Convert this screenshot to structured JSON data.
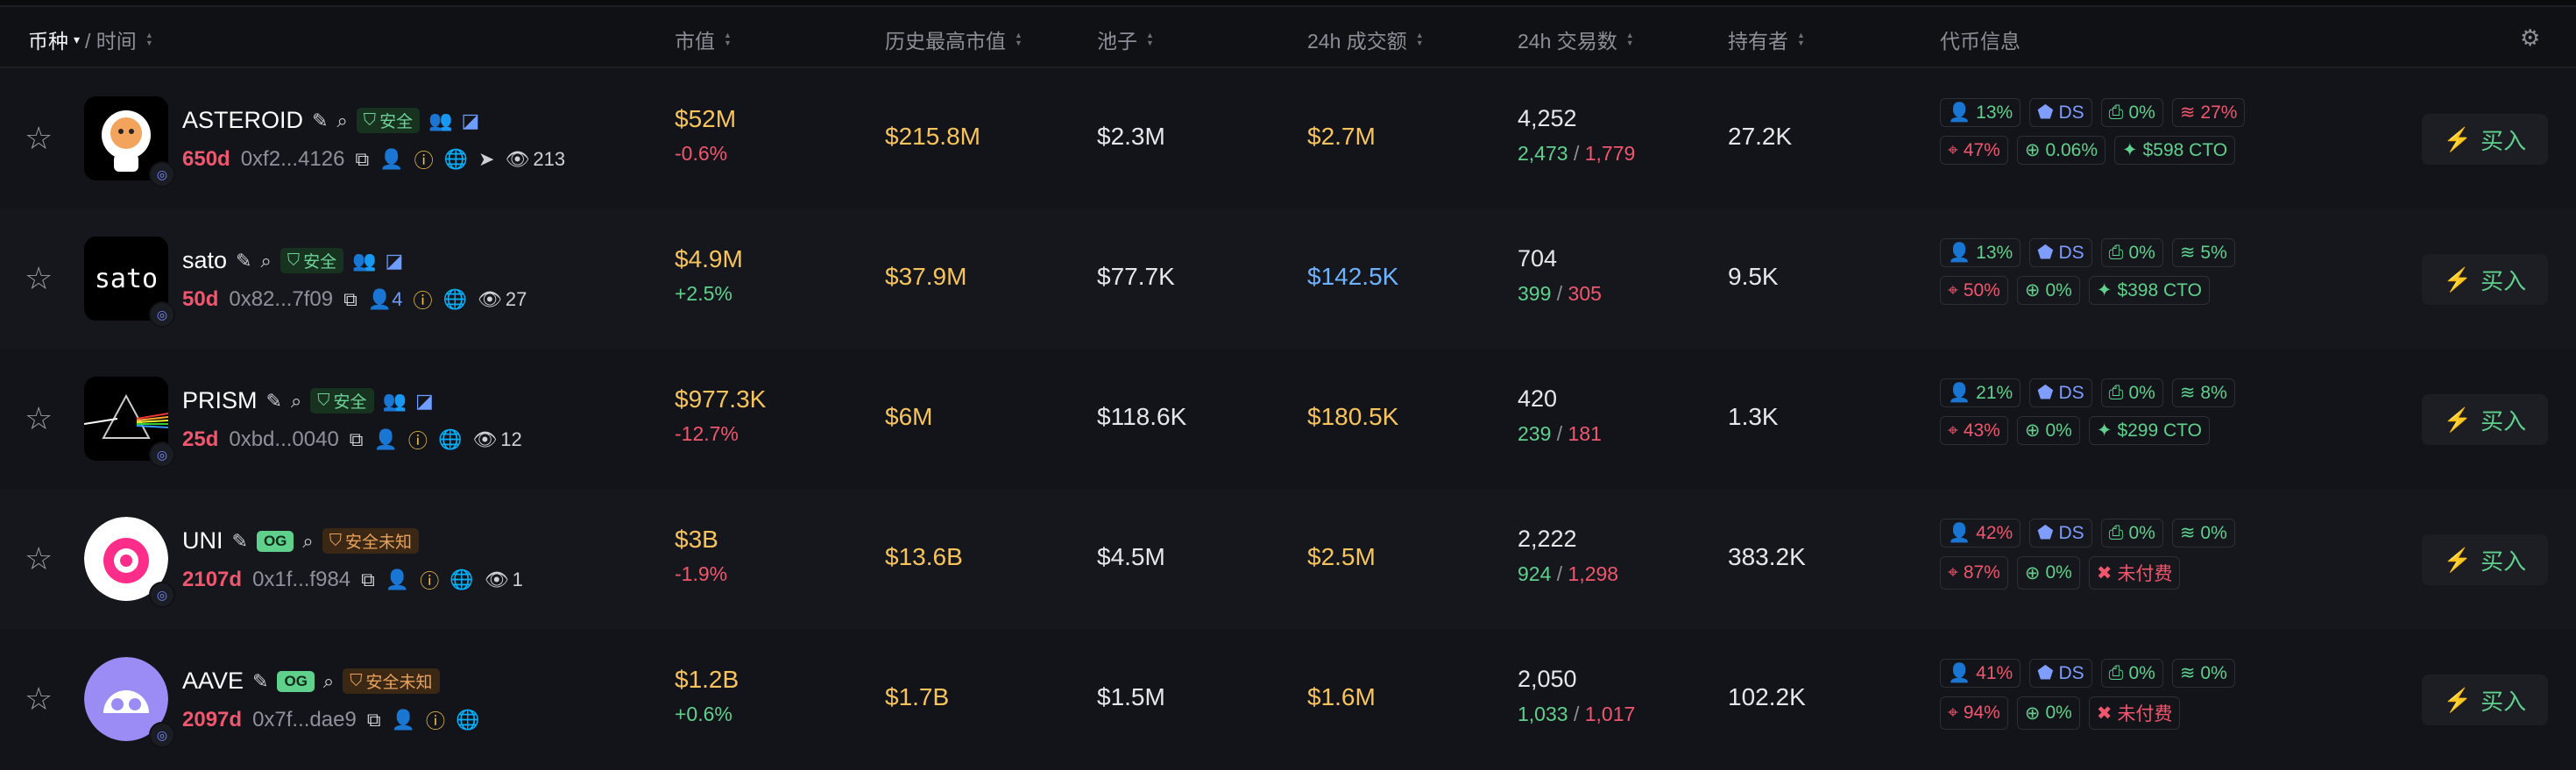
{
  "header": {
    "coin": "币种",
    "time": "/ 时间",
    "mcap": "市值",
    "ath": "历史最高市值",
    "pool": "池子",
    "volume": "24h 成交额",
    "txcount": "24h 交易数",
    "holders": "持有者",
    "tokeninfo": "代币信息"
  },
  "buy_label": "买入",
  "rows": [
    {
      "name": "ASTEROID",
      "tag": "安全",
      "tagtype": "safe",
      "og": "",
      "age": "650d",
      "addr": "0xf2...4126",
      "holders_inline": "",
      "views": "213",
      "mcap": "$52M",
      "change": "-0.6%",
      "change_dir": "neg",
      "ath": "$215.8M",
      "pool": "$2.3M",
      "volume": "$2.7M",
      "volume_color": "gold",
      "tx": "4,252",
      "buys": "2,473",
      "sells": "1,779",
      "holders": "27.2K",
      "chips1": [
        {
          "icon": "holder-icon",
          "text": "13%",
          "color": "green"
        },
        {
          "icon": "ds-icon",
          "text": "DS",
          "color": "blue"
        },
        {
          "icon": "dev-icon",
          "text": "0%",
          "color": "green"
        },
        {
          "icon": "layers-icon",
          "text": "27%",
          "color": "red"
        }
      ],
      "chips2": [
        {
          "icon": "sniper-icon",
          "text": "47%",
          "color": "red"
        },
        {
          "icon": "target-icon",
          "text": "0.06%",
          "color": "green"
        },
        {
          "icon": "cto-icon",
          "text": "$598 CTO",
          "color": "green"
        }
      ],
      "avatar": "astronaut"
    },
    {
      "name": "sato",
      "tag": "安全",
      "tagtype": "safe",
      "og": "",
      "age": "50d",
      "addr": "0x82...7f09",
      "holders_inline": "4",
      "views": "27",
      "mcap": "$4.9M",
      "change": "+2.5%",
      "change_dir": "pos",
      "ath": "$37.9M",
      "pool": "$77.7K",
      "volume": "$142.5K",
      "volume_color": "blue",
      "tx": "704",
      "buys": "399",
      "sells": "305",
      "holders": "9.5K",
      "chips1": [
        {
          "icon": "holder-icon",
          "text": "13%",
          "color": "green"
        },
        {
          "icon": "ds-icon",
          "text": "DS",
          "color": "blue"
        },
        {
          "icon": "dev-icon",
          "text": "0%",
          "color": "green"
        },
        {
          "icon": "layers-icon",
          "text": "5%",
          "color": "green"
        }
      ],
      "chips2": [
        {
          "icon": "sniper-icon",
          "text": "50%",
          "color": "red"
        },
        {
          "icon": "target-icon",
          "text": "0%",
          "color": "green"
        },
        {
          "icon": "cto-icon",
          "text": "$398 CTO",
          "color": "green"
        }
      ],
      "avatar": "sato"
    },
    {
      "name": "PRISM",
      "tag": "安全",
      "tagtype": "safe",
      "og": "",
      "age": "25d",
      "addr": "0xbd...0040",
      "holders_inline": "",
      "views": "12",
      "mcap": "$977.3K",
      "change": "-12.7%",
      "change_dir": "neg",
      "ath": "$6M",
      "pool": "$118.6K",
      "volume": "$180.5K",
      "volume_color": "gold",
      "tx": "420",
      "buys": "239",
      "sells": "181",
      "holders": "1.3K",
      "chips1": [
        {
          "icon": "holder-icon",
          "text": "21%",
          "color": "green"
        },
        {
          "icon": "ds-icon",
          "text": "DS",
          "color": "blue"
        },
        {
          "icon": "dev-icon",
          "text": "0%",
          "color": "green"
        },
        {
          "icon": "layers-icon",
          "text": "8%",
          "color": "green"
        }
      ],
      "chips2": [
        {
          "icon": "sniper-icon",
          "text": "43%",
          "color": "red"
        },
        {
          "icon": "target-icon",
          "text": "0%",
          "color": "green"
        },
        {
          "icon": "cto-icon",
          "text": "$299 CTO",
          "color": "green"
        }
      ],
      "avatar": "prism"
    },
    {
      "name": "UNI",
      "tag": "安全未知",
      "tagtype": "unk",
      "og": "OG",
      "age": "2107d",
      "addr": "0x1f...f984",
      "holders_inline": "",
      "views": "1",
      "mcap": "$3B",
      "change": "-1.9%",
      "change_dir": "neg",
      "ath": "$13.6B",
      "pool": "$4.5M",
      "volume": "$2.5M",
      "volume_color": "gold",
      "tx": "2,222",
      "buys": "924",
      "sells": "1,298",
      "holders": "383.2K",
      "chips1": [
        {
          "icon": "holder-icon",
          "text": "42%",
          "color": "red"
        },
        {
          "icon": "ds-icon",
          "text": "DS",
          "color": "blue"
        },
        {
          "icon": "dev-icon",
          "text": "0%",
          "color": "green"
        },
        {
          "icon": "layers-icon",
          "text": "0%",
          "color": "green"
        }
      ],
      "chips2": [
        {
          "icon": "sniper-icon",
          "text": "87%",
          "color": "red"
        },
        {
          "icon": "target-icon",
          "text": "0%",
          "color": "green"
        },
        {
          "icon": "unpaid-icon",
          "text": "未付费",
          "color": "red"
        }
      ],
      "avatar": "uni"
    },
    {
      "name": "AAVE",
      "tag": "安全未知",
      "tagtype": "unk",
      "og": "OG",
      "age": "2097d",
      "addr": "0x7f...dae9",
      "holders_inline": "",
      "views": "",
      "mcap": "$1.2B",
      "change": "+0.6%",
      "change_dir": "pos",
      "ath": "$1.7B",
      "pool": "$1.5M",
      "volume": "$1.6M",
      "volume_color": "gold",
      "tx": "2,050",
      "buys": "1,033",
      "sells": "1,017",
      "holders": "102.2K",
      "chips1": [
        {
          "icon": "holder-icon",
          "text": "41%",
          "color": "red"
        },
        {
          "icon": "ds-icon",
          "text": "DS",
          "color": "blue"
        },
        {
          "icon": "dev-icon",
          "text": "0%",
          "color": "green"
        },
        {
          "icon": "layers-icon",
          "text": "0%",
          "color": "green"
        }
      ],
      "chips2": [
        {
          "icon": "sniper-icon",
          "text": "94%",
          "color": "red"
        },
        {
          "icon": "target-icon",
          "text": "0%",
          "color": "green"
        },
        {
          "icon": "unpaid-icon",
          "text": "未付费",
          "color": "red"
        }
      ],
      "avatar": "aave"
    }
  ]
}
